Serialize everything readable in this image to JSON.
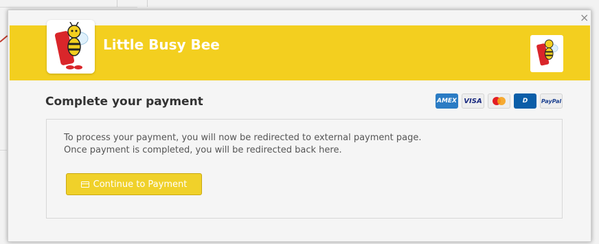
{
  "header": {
    "brand": "Little Busy Bee"
  },
  "dialog": {
    "close_label": "×",
    "title": "Complete your payment",
    "message_line1": "To process your payment, you will now be redirected to external payment page.",
    "message_line2": "Once payment is completed, you will be redirected back here.",
    "continue_button": "Continue to Payment"
  },
  "payment_methods": [
    {
      "name": "amex",
      "label": "AMEX"
    },
    {
      "name": "visa",
      "label": "VISA"
    },
    {
      "name": "mastercard",
      "label": ""
    },
    {
      "name": "diners",
      "label": "D"
    },
    {
      "name": "paypal",
      "label": "PayPal"
    }
  ],
  "colors": {
    "accent": "#f3cf1f",
    "button": "#f0d12a"
  }
}
